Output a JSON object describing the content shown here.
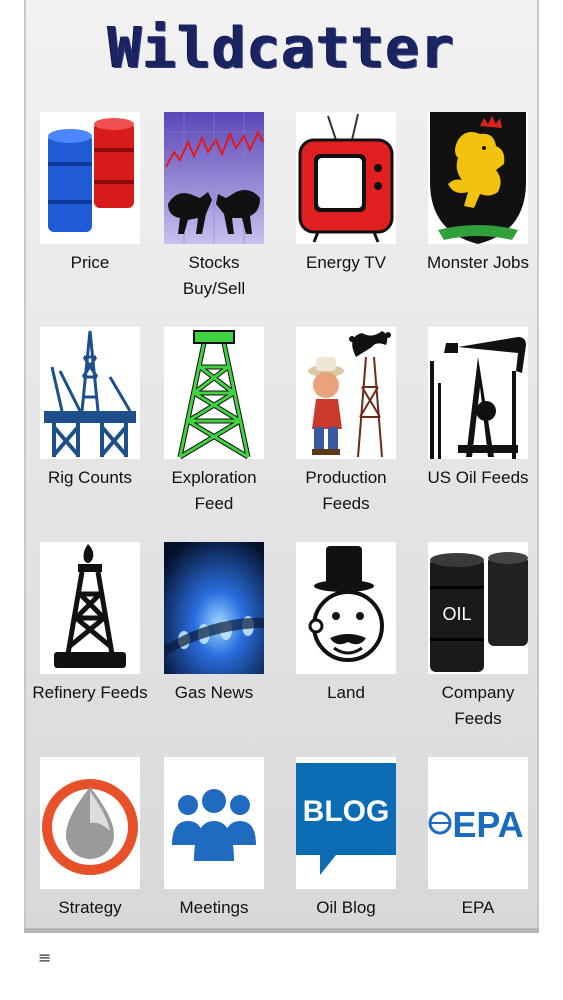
{
  "app": {
    "title": "Wildcatter"
  },
  "tiles": [
    {
      "label": "Price",
      "icon": "oil-barrels-icon"
    },
    {
      "label": "Stocks\nBuy/Sell",
      "icon": "bull-bear-chart-icon"
    },
    {
      "label": "Energy TV",
      "icon": "tv-icon"
    },
    {
      "label": "Monster Jobs",
      "icon": "lion-crest-icon"
    },
    {
      "label": "Rig Counts",
      "icon": "offshore-rig-icon"
    },
    {
      "label": "Exploration\nFeed",
      "icon": "green-derrick-icon"
    },
    {
      "label": "Production\nFeeds",
      "icon": "gusher-cartoon-icon"
    },
    {
      "label": "US Oil Feeds",
      "icon": "pumpjack-icon"
    },
    {
      "label": "Refinery Feeds",
      "icon": "flare-derrick-icon"
    },
    {
      "label": "Gas News",
      "icon": "gas-flame-icon"
    },
    {
      "label": "Land",
      "icon": "monopoly-man-icon"
    },
    {
      "label": "Company\nFeeds",
      "icon": "oil-drums-icon",
      "text": "OIL"
    },
    {
      "label": "Strategy",
      "icon": "oil-drop-icon"
    },
    {
      "label": "Meetings",
      "icon": "people-group-icon"
    },
    {
      "label": "Oil Blog",
      "icon": "blog-bubble-icon",
      "text": "BLOG"
    },
    {
      "label": "EPA",
      "icon": "epa-logo-icon",
      "text": "EPA"
    }
  ],
  "footer": {
    "menu_glyph": "≡"
  },
  "colors": {
    "title": "#1b2462",
    "blog_blue": "#0b6bb3",
    "epa_blue": "#1b6cc0",
    "derrick_green": "#3fd33f"
  }
}
